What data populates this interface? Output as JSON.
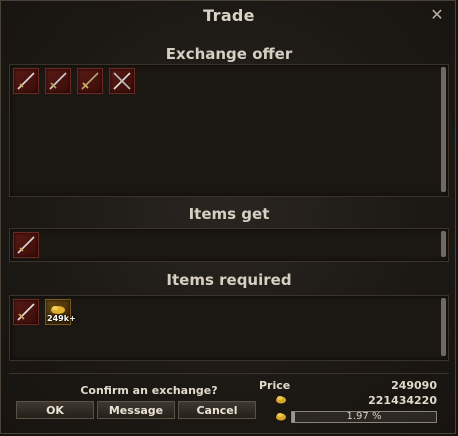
{
  "window": {
    "title": "Trade",
    "close_icon": "close-icon"
  },
  "sections": {
    "exchange_offer": {
      "title": "Exchange offer",
      "items": [
        {
          "icon": "sword-icon"
        },
        {
          "icon": "sword-icon"
        },
        {
          "icon": "sword-icon"
        },
        {
          "icon": "sword-icon"
        }
      ]
    },
    "items_get": {
      "title": "Items get",
      "items": [
        {
          "icon": "sword-icon"
        }
      ]
    },
    "items_required": {
      "title": "Items required",
      "items": [
        {
          "icon": "sword-icon"
        },
        {
          "icon": "gold-pile-icon",
          "badge": "249k+"
        }
      ]
    }
  },
  "footer": {
    "confirm_text": "Confirm an exchange?",
    "buttons": {
      "ok": "OK",
      "message": "Message",
      "cancel": "Cancel"
    },
    "price_label": "Price",
    "price_value": "249090",
    "balance_value": "221434220",
    "progress_text": "1.97 %",
    "progress_fraction": 0.0197
  },
  "colors": {
    "slot_red": "#5a1a14",
    "slot_gold": "#6a4a14",
    "text": "#e0d9cc"
  }
}
